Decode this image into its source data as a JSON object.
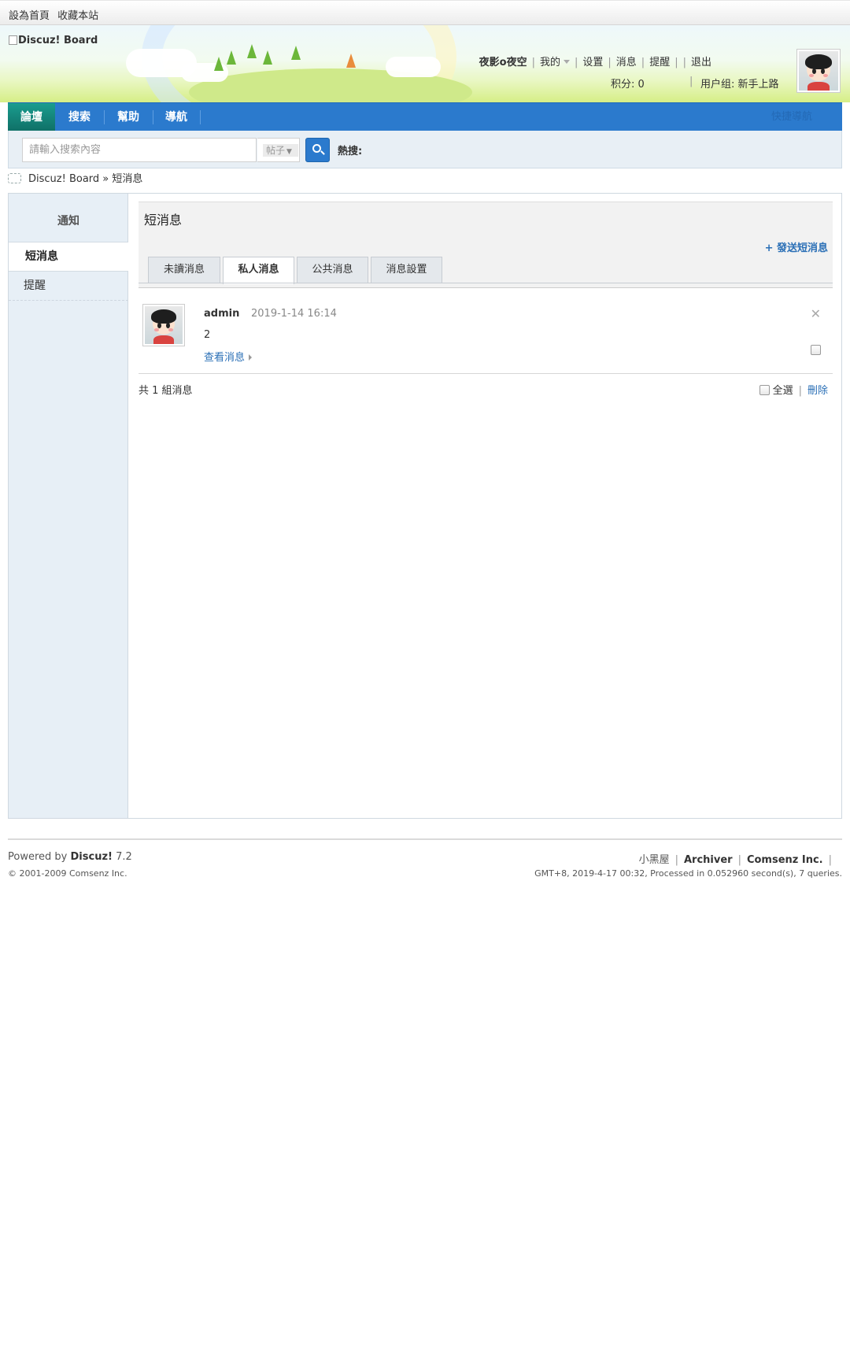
{
  "topbar": {
    "set_home": "設為首頁",
    "bookmark": "收藏本站"
  },
  "header": {
    "logo_alt": "Discuz! Board",
    "username": "夜影o夜空",
    "my": "我的",
    "settings": "设置",
    "messages": "消息",
    "reminders": "提醒",
    "logout": "退出",
    "points": "积分: 0",
    "usergroup": "用户组: 新手上路"
  },
  "nav": {
    "items": [
      "論壇",
      "搜索",
      "幫助",
      "導航"
    ],
    "quick": "快捷導航",
    "active_color": "#148a7f",
    "bar_color": "#2b7acd"
  },
  "search": {
    "placeholder": "請輸入搜索內容",
    "type": "帖子",
    "hot_label": "熱搜:"
  },
  "breadcrumb": {
    "site": "Discuz! Board",
    "sep": "»",
    "current": "短消息"
  },
  "sidebar": {
    "title": "通知",
    "items": [
      "短消息",
      "提醒"
    ]
  },
  "panel": {
    "title": "短消息",
    "send": "+ 發送短消息",
    "tabs": [
      "未讀消息",
      "私人消息",
      "公共消息",
      "消息設置"
    ]
  },
  "messages": [
    {
      "sender": "admin",
      "time": "2019-1-14 16:14",
      "body": "2",
      "view": "查看消息"
    }
  ],
  "list_footer": {
    "total": "共 1 組消息",
    "select_all": "全選",
    "delete": "刪除"
  },
  "footer": {
    "powered_prefix": "Powered by",
    "product": "Discuz!",
    "version": "7.2",
    "copyright": "© 2001-2009 Comsenz Inc.",
    "link_small": "小黑屋",
    "link_archiver": "Archiver",
    "link_company": "Comsenz Inc.",
    "stats": "GMT+8, 2019-4-17 00:32, Processed in 0.052960 second(s), 7 queries."
  }
}
